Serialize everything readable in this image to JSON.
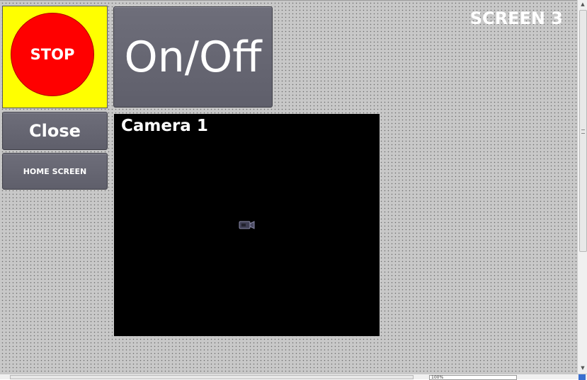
{
  "screen": {
    "title": "SCREEN 3"
  },
  "buttons": {
    "stop_label": "STOP",
    "onoff_label": "On/Off",
    "close_label": "Close",
    "home_label": "HOME SCREEN"
  },
  "camera": {
    "label": "Camera 1",
    "icon": "video-camera-icon"
  },
  "statusbar": {
    "zoom": "100%"
  },
  "colors": {
    "stop_background": "#ffff00",
    "stop_circle": "#ff0000",
    "button": "#65656f",
    "camera_background": "#000000",
    "canvas": "#c8c8c8"
  }
}
